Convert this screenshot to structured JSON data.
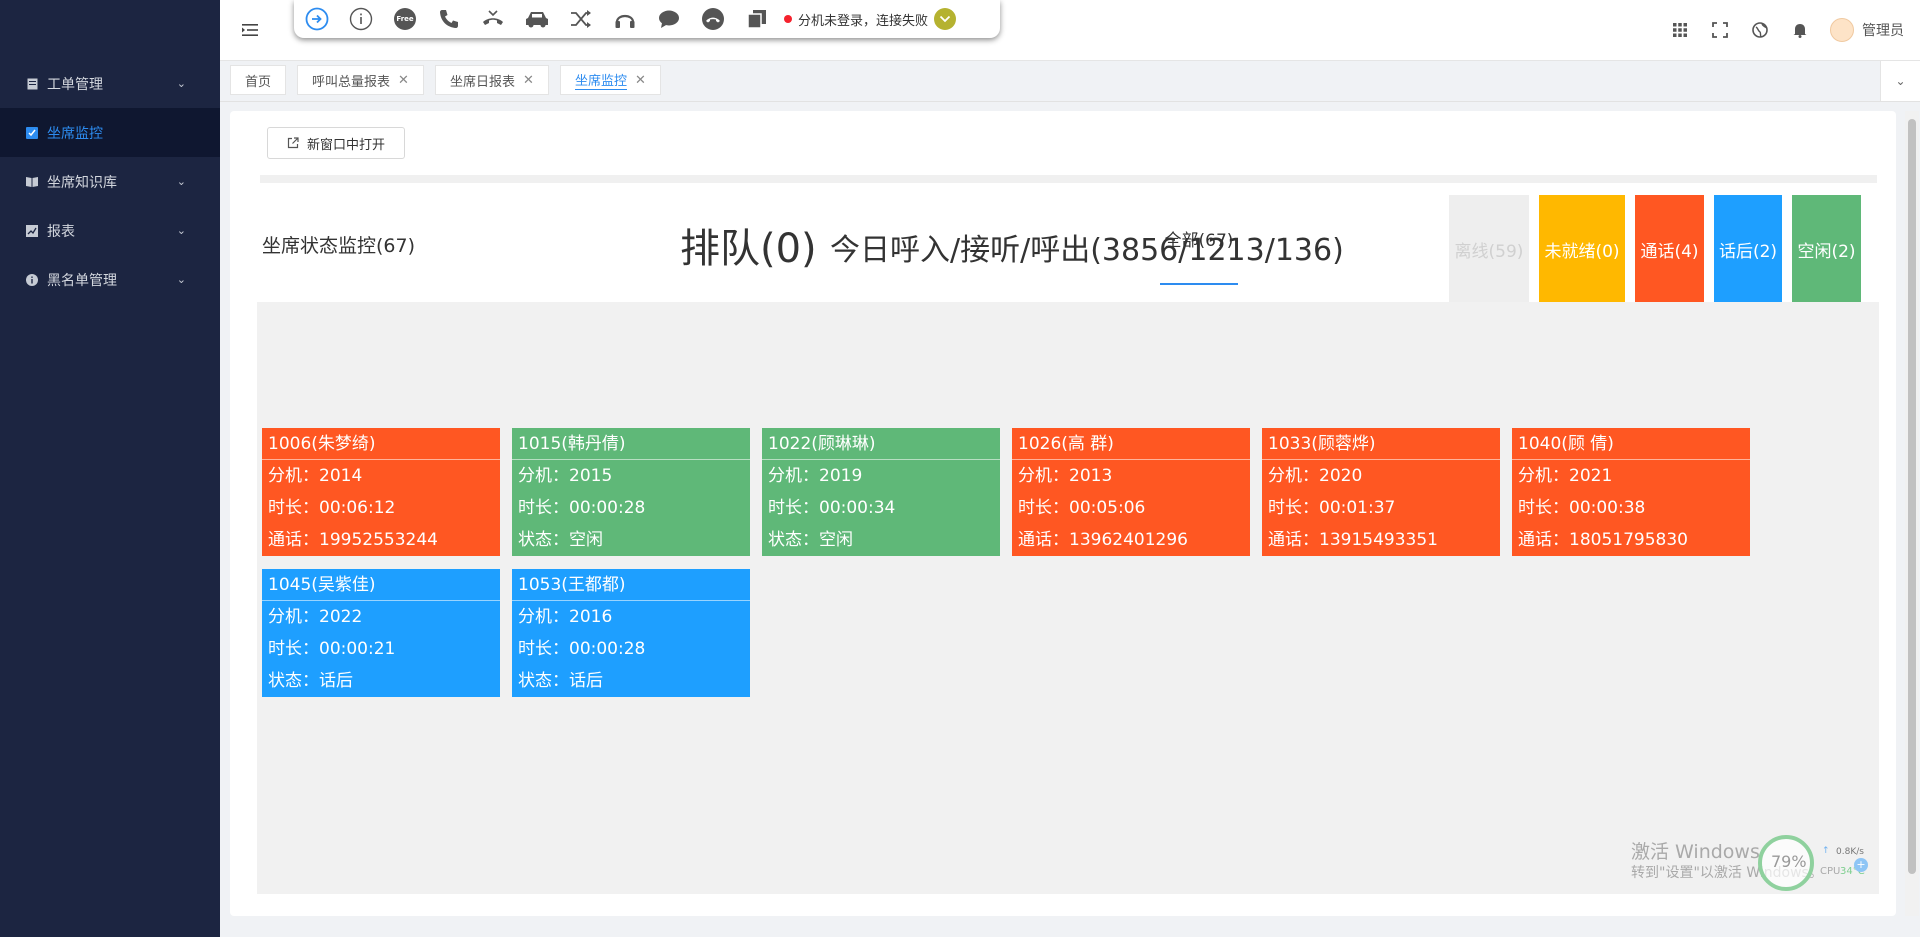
{
  "sidebar": {
    "items": [
      {
        "label": "工单管理",
        "icon": "document-icon",
        "has_arrow": true
      },
      {
        "label": "坐席监控",
        "icon": "checkbox-icon",
        "has_arrow": false,
        "active": true
      },
      {
        "label": "坐席知识库",
        "icon": "book-icon",
        "has_arrow": true
      },
      {
        "label": "报表",
        "icon": "chart-icon",
        "has_arrow": true
      },
      {
        "label": "黑名单管理",
        "icon": "info-icon",
        "has_arrow": true
      }
    ]
  },
  "toolbar": {
    "free_label": "Free",
    "status_text": "分机未登录，连接失败"
  },
  "header": {
    "username": "管理员"
  },
  "tabs": [
    {
      "label": "首页",
      "closable": false
    },
    {
      "label": "呼叫总量报表",
      "closable": true
    },
    {
      "label": "坐席日报表",
      "closable": true
    },
    {
      "label": "坐席监控",
      "closable": true,
      "active": true
    }
  ],
  "panel": {
    "open_new_window": "新窗口中打开",
    "monitor_title": "坐席状态监控(67)",
    "queue": "排队(0)",
    "today": "今日呼入/接听/呼出(3856/1213/136)",
    "filters": [
      {
        "label": "全部(67)",
        "color": "#ffffff"
      },
      {
        "label": "离线(59)",
        "color": "#eeeeee"
      },
      {
        "label": "未就绪(0)",
        "color": "#ffb800"
      },
      {
        "label": "通话(4)",
        "color": "#ff5722"
      },
      {
        "label": "话后(2)",
        "color": "#1e9fff"
      },
      {
        "label": "空闲(2)",
        "color": "#5fb878"
      }
    ]
  },
  "agents": [
    {
      "name": "1006(朱梦绮)",
      "ext": "分机：2014",
      "dur": "时长：00:06:12",
      "info": "通话：19952553244",
      "state": "red"
    },
    {
      "name": "1015(韩丹倩)",
      "ext": "分机：2015",
      "dur": "时长：00:00:28",
      "info": "状态：空闲",
      "state": "green"
    },
    {
      "name": "1022(顾琳琳)",
      "ext": "分机：2019",
      "dur": "时长：00:00:34",
      "info": "状态：空闲",
      "state": "green"
    },
    {
      "name": "1026(高 群)",
      "ext": "分机：2013",
      "dur": "时长：00:05:06",
      "info": "通话：13962401296",
      "state": "red"
    },
    {
      "name": "1033(顾蓉烨)",
      "ext": "分机：2020",
      "dur": "时长：00:01:37",
      "info": "通话：13915493351",
      "state": "red"
    },
    {
      "name": "1040(顾 倩)",
      "ext": "分机：2021",
      "dur": "时长：00:00:38",
      "info": "通话：18051795830",
      "state": "red"
    },
    {
      "name": "1045(吴紫佳)",
      "ext": "分机：2022",
      "dur": "时长：00:00:21",
      "info": "状态：话后",
      "state": "blue"
    },
    {
      "name": "1053(王都都)",
      "ext": "分机：2016",
      "dur": "时长：00:00:28",
      "info": "状态：话后",
      "state": "blue"
    }
  ],
  "watermark": {
    "line1": "激活 Windows",
    "line2": "转到\"设置\"以激活 Windows。"
  },
  "sys_widget": {
    "cpu_pct": "79%",
    "net_speed": "0.8K/s",
    "cpu_label": "CPU",
    "cpu_temp": "34°C"
  }
}
